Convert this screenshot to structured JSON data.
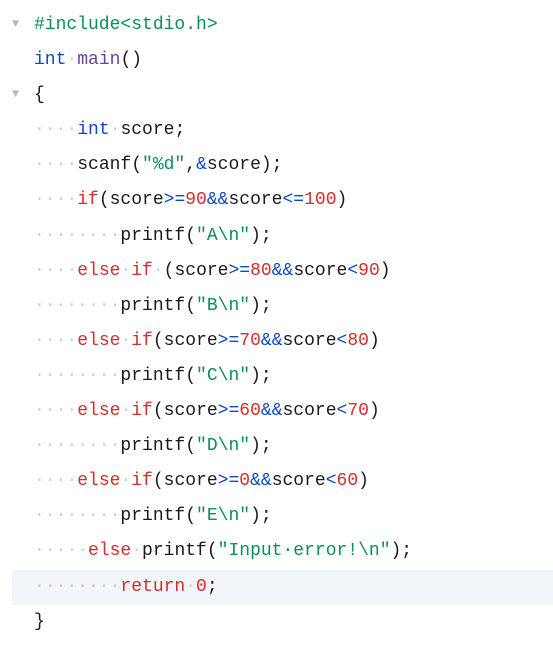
{
  "code": {
    "lines": [
      {
        "fold": "▼",
        "highlighted": false,
        "tokens": [
          {
            "cls": "preproc",
            "t": "#include<stdio.h>"
          }
        ]
      },
      {
        "fold": "",
        "highlighted": false,
        "tokens": [
          {
            "cls": "keyword-type",
            "t": "int"
          },
          {
            "cls": "ws-dot",
            "t": "·"
          },
          {
            "cls": "func-name",
            "t": "main"
          },
          {
            "cls": "punct",
            "t": "()"
          }
        ]
      },
      {
        "fold": "▼",
        "highlighted": false,
        "tokens": [
          {
            "cls": "punct",
            "t": "{"
          }
        ]
      },
      {
        "fold": "",
        "highlighted": false,
        "tokens": [
          {
            "cls": "ws-dot",
            "t": "····"
          },
          {
            "cls": "keyword-type",
            "t": "int"
          },
          {
            "cls": "ws-dot",
            "t": "·"
          },
          {
            "cls": "ident",
            "t": "score;"
          }
        ]
      },
      {
        "fold": "",
        "highlighted": false,
        "tokens": [
          {
            "cls": "ws-dot",
            "t": "····"
          },
          {
            "cls": "ident",
            "t": "scanf("
          },
          {
            "cls": "string",
            "t": "\"%d\""
          },
          {
            "cls": "punct",
            "t": ","
          },
          {
            "cls": "operator",
            "t": "&"
          },
          {
            "cls": "ident",
            "t": "score);"
          }
        ]
      },
      {
        "fold": "",
        "highlighted": false,
        "tokens": [
          {
            "cls": "ws-dot",
            "t": "····"
          },
          {
            "cls": "keyword-ctrl",
            "t": "if"
          },
          {
            "cls": "punct",
            "t": "(score"
          },
          {
            "cls": "operator",
            "t": ">="
          },
          {
            "cls": "number",
            "t": "90"
          },
          {
            "cls": "operator",
            "t": "&&"
          },
          {
            "cls": "ident",
            "t": "score"
          },
          {
            "cls": "operator",
            "t": "<="
          },
          {
            "cls": "number",
            "t": "100"
          },
          {
            "cls": "punct",
            "t": ")"
          }
        ]
      },
      {
        "fold": "",
        "highlighted": false,
        "tokens": [
          {
            "cls": "ws-dot",
            "t": "········"
          },
          {
            "cls": "ident",
            "t": "printf("
          },
          {
            "cls": "string",
            "t": "\"A\\n\""
          },
          {
            "cls": "punct",
            "t": ");"
          }
        ]
      },
      {
        "fold": "",
        "highlighted": false,
        "tokens": [
          {
            "cls": "ws-dot",
            "t": "····"
          },
          {
            "cls": "keyword-ctrl",
            "t": "else"
          },
          {
            "cls": "ws-dot",
            "t": "·"
          },
          {
            "cls": "keyword-ctrl",
            "t": "if"
          },
          {
            "cls": "ws-dot",
            "t": "·"
          },
          {
            "cls": "punct",
            "t": "(score"
          },
          {
            "cls": "operator",
            "t": ">="
          },
          {
            "cls": "number",
            "t": "80"
          },
          {
            "cls": "operator",
            "t": "&&"
          },
          {
            "cls": "ident",
            "t": "score"
          },
          {
            "cls": "operator",
            "t": "<"
          },
          {
            "cls": "number",
            "t": "90"
          },
          {
            "cls": "punct",
            "t": ")"
          }
        ]
      },
      {
        "fold": "",
        "highlighted": false,
        "tokens": [
          {
            "cls": "ws-dot",
            "t": "········"
          },
          {
            "cls": "ident",
            "t": "printf("
          },
          {
            "cls": "string",
            "t": "\"B\\n\""
          },
          {
            "cls": "punct",
            "t": ");"
          }
        ]
      },
      {
        "fold": "",
        "highlighted": false,
        "tokens": [
          {
            "cls": "ws-dot",
            "t": "····"
          },
          {
            "cls": "keyword-ctrl",
            "t": "else"
          },
          {
            "cls": "ws-dot",
            "t": "·"
          },
          {
            "cls": "keyword-ctrl",
            "t": "if"
          },
          {
            "cls": "punct",
            "t": "(score"
          },
          {
            "cls": "operator",
            "t": ">="
          },
          {
            "cls": "number",
            "t": "70"
          },
          {
            "cls": "operator",
            "t": "&&"
          },
          {
            "cls": "ident",
            "t": "score"
          },
          {
            "cls": "operator",
            "t": "<"
          },
          {
            "cls": "number",
            "t": "80"
          },
          {
            "cls": "punct",
            "t": ")"
          }
        ]
      },
      {
        "fold": "",
        "highlighted": false,
        "tokens": [
          {
            "cls": "ws-dot",
            "t": "········"
          },
          {
            "cls": "ident",
            "t": "printf("
          },
          {
            "cls": "string",
            "t": "\"C\\n\""
          },
          {
            "cls": "punct",
            "t": ");"
          }
        ]
      },
      {
        "fold": "",
        "highlighted": false,
        "tokens": [
          {
            "cls": "ws-dot",
            "t": "····"
          },
          {
            "cls": "keyword-ctrl",
            "t": "else"
          },
          {
            "cls": "ws-dot",
            "t": "·"
          },
          {
            "cls": "keyword-ctrl",
            "t": "if"
          },
          {
            "cls": "punct",
            "t": "(score"
          },
          {
            "cls": "operator",
            "t": ">="
          },
          {
            "cls": "number",
            "t": "60"
          },
          {
            "cls": "operator",
            "t": "&&"
          },
          {
            "cls": "ident",
            "t": "score"
          },
          {
            "cls": "operator",
            "t": "<"
          },
          {
            "cls": "number",
            "t": "70"
          },
          {
            "cls": "punct",
            "t": ")"
          }
        ]
      },
      {
        "fold": "",
        "highlighted": false,
        "tokens": [
          {
            "cls": "ws-dot",
            "t": "········"
          },
          {
            "cls": "ident",
            "t": "printf("
          },
          {
            "cls": "string",
            "t": "\"D\\n\""
          },
          {
            "cls": "punct",
            "t": ");"
          }
        ]
      },
      {
        "fold": "",
        "highlighted": false,
        "tokens": [
          {
            "cls": "ws-dot",
            "t": "····"
          },
          {
            "cls": "keyword-ctrl",
            "t": "else"
          },
          {
            "cls": "ws-dot",
            "t": "·"
          },
          {
            "cls": "keyword-ctrl",
            "t": "if"
          },
          {
            "cls": "punct",
            "t": "(score"
          },
          {
            "cls": "operator",
            "t": ">="
          },
          {
            "cls": "number",
            "t": "0"
          },
          {
            "cls": "operator",
            "t": "&&"
          },
          {
            "cls": "ident",
            "t": "score"
          },
          {
            "cls": "operator",
            "t": "<"
          },
          {
            "cls": "number",
            "t": "60"
          },
          {
            "cls": "punct",
            "t": ")"
          }
        ]
      },
      {
        "fold": "",
        "highlighted": false,
        "tokens": [
          {
            "cls": "ws-dot",
            "t": "········"
          },
          {
            "cls": "ident",
            "t": "printf("
          },
          {
            "cls": "string",
            "t": "\"E\\n\""
          },
          {
            "cls": "punct",
            "t": ");"
          }
        ]
      },
      {
        "fold": "",
        "highlighted": false,
        "tokens": [
          {
            "cls": "ws-dot",
            "t": "·····"
          },
          {
            "cls": "keyword-ctrl",
            "t": "else"
          },
          {
            "cls": "ws-dot",
            "t": "·"
          },
          {
            "cls": "ident",
            "t": "printf("
          },
          {
            "cls": "string",
            "t": "\"Input·error!\\n\""
          },
          {
            "cls": "punct",
            "t": ");"
          }
        ]
      },
      {
        "fold": "",
        "highlighted": true,
        "tokens": [
          {
            "cls": "ws-dot",
            "t": "········"
          },
          {
            "cls": "keyword-ctrl",
            "t": "return"
          },
          {
            "cls": "ws-dot",
            "t": "·"
          },
          {
            "cls": "number",
            "t": "0"
          },
          {
            "cls": "punct",
            "t": ";"
          }
        ]
      },
      {
        "fold": "",
        "highlighted": false,
        "tokens": [
          {
            "cls": "punct",
            "t": "}"
          }
        ]
      }
    ]
  }
}
